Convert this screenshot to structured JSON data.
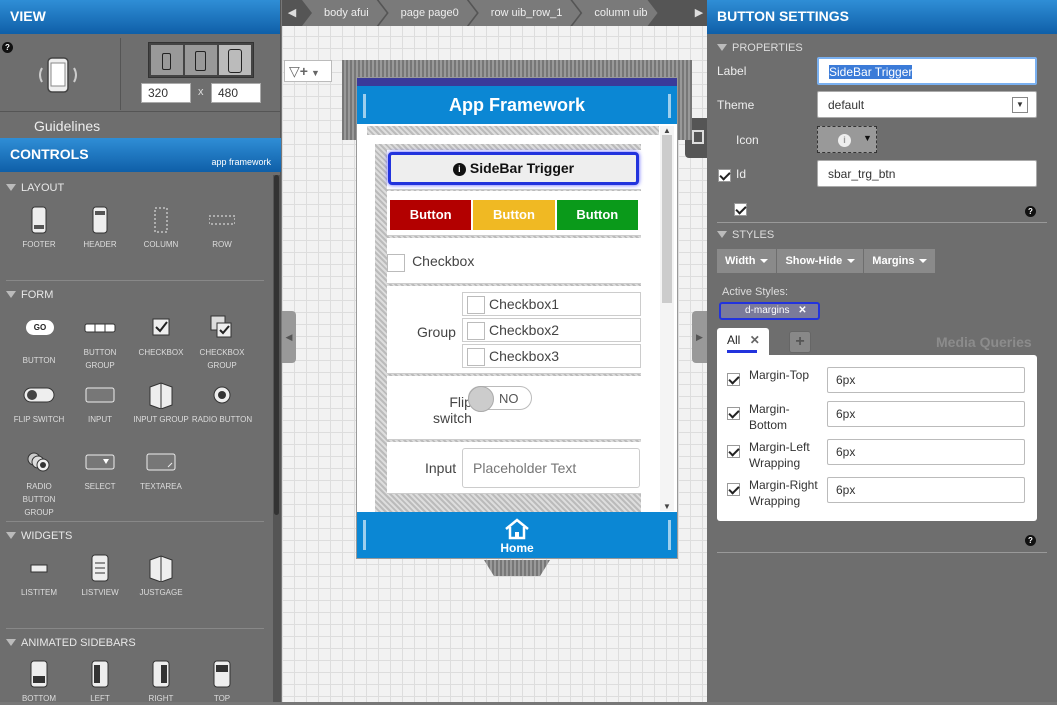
{
  "view": {
    "title": "VIEW",
    "width_value": "320",
    "height_value": "480",
    "times": "x",
    "guidelines_label": "Guidelines"
  },
  "controls": {
    "title": "CONTROLS",
    "subtitle": "app framework",
    "sections": {
      "layout": "LAYOUT",
      "form": "FORM",
      "widgets": "WIDGETS",
      "animated": "ANIMATED SIDEBARS"
    },
    "layout_items": [
      "FOOTER",
      "HEADER",
      "COLUMN",
      "ROW"
    ],
    "form_items": [
      "BUTTON",
      "BUTTON GROUP",
      "CHECKBOX",
      "CHECKBOX GROUP",
      "FLIP SWITCH",
      "INPUT",
      "INPUT GROUP",
      "RADIO BUTTON",
      "RADIO BUTTON GROUP",
      "SELECT",
      "TEXTAREA"
    ],
    "widget_items": [
      "LISTITEM",
      "LISTVIEW",
      "JUSTGAGE"
    ],
    "sidebar_items": [
      "BOTTOM",
      "LEFT",
      "RIGHT",
      "TOP"
    ],
    "go_label": "GO"
  },
  "breadcrumb": [
    "body afui",
    "page page0",
    "row uib_row_1",
    "column uib"
  ],
  "phone": {
    "header_title": "App Framework",
    "sidebar_trigger": "SideBar Trigger",
    "buttons": [
      "Button",
      "Button",
      "Button"
    ],
    "button_colors": [
      "#b30000",
      "#f0b923",
      "#0a9a1a"
    ],
    "checkbox_label": "Checkbox",
    "group_label": "Group",
    "group_items": [
      "Checkbox1",
      "Checkbox2",
      "Checkbox3"
    ],
    "flip_label_1": "Flip",
    "flip_label_2": "switch",
    "flip_value": "NO",
    "input_label": "Input",
    "input_placeholder": "Placeholder Text",
    "footer_label": "Home"
  },
  "settings": {
    "title": "BUTTON SETTINGS",
    "properties_label": "PROPERTIES",
    "label_label": "Label",
    "label_value": "SideBar Trigger",
    "theme_label": "Theme",
    "theme_value": "default",
    "icon_label": "Icon",
    "id_label": "Id",
    "id_value": "sbar_trg_btn",
    "styles_label": "STYLES",
    "style_buttons": [
      "Width",
      "Show-Hide",
      "Margins"
    ],
    "active_styles_label": "Active Styles:",
    "active_style": "d-margins",
    "tab_all": "All",
    "media_queries": "Media Queries",
    "margins": [
      {
        "label": "Margin-Top",
        "value": "6px"
      },
      {
        "label": "Margin-Bottom",
        "value": "6px"
      },
      {
        "label": "Margin-Left Wrapping",
        "value": "6px"
      },
      {
        "label": "Margin-Right Wrapping",
        "value": "6px"
      }
    ],
    "help": "?"
  }
}
